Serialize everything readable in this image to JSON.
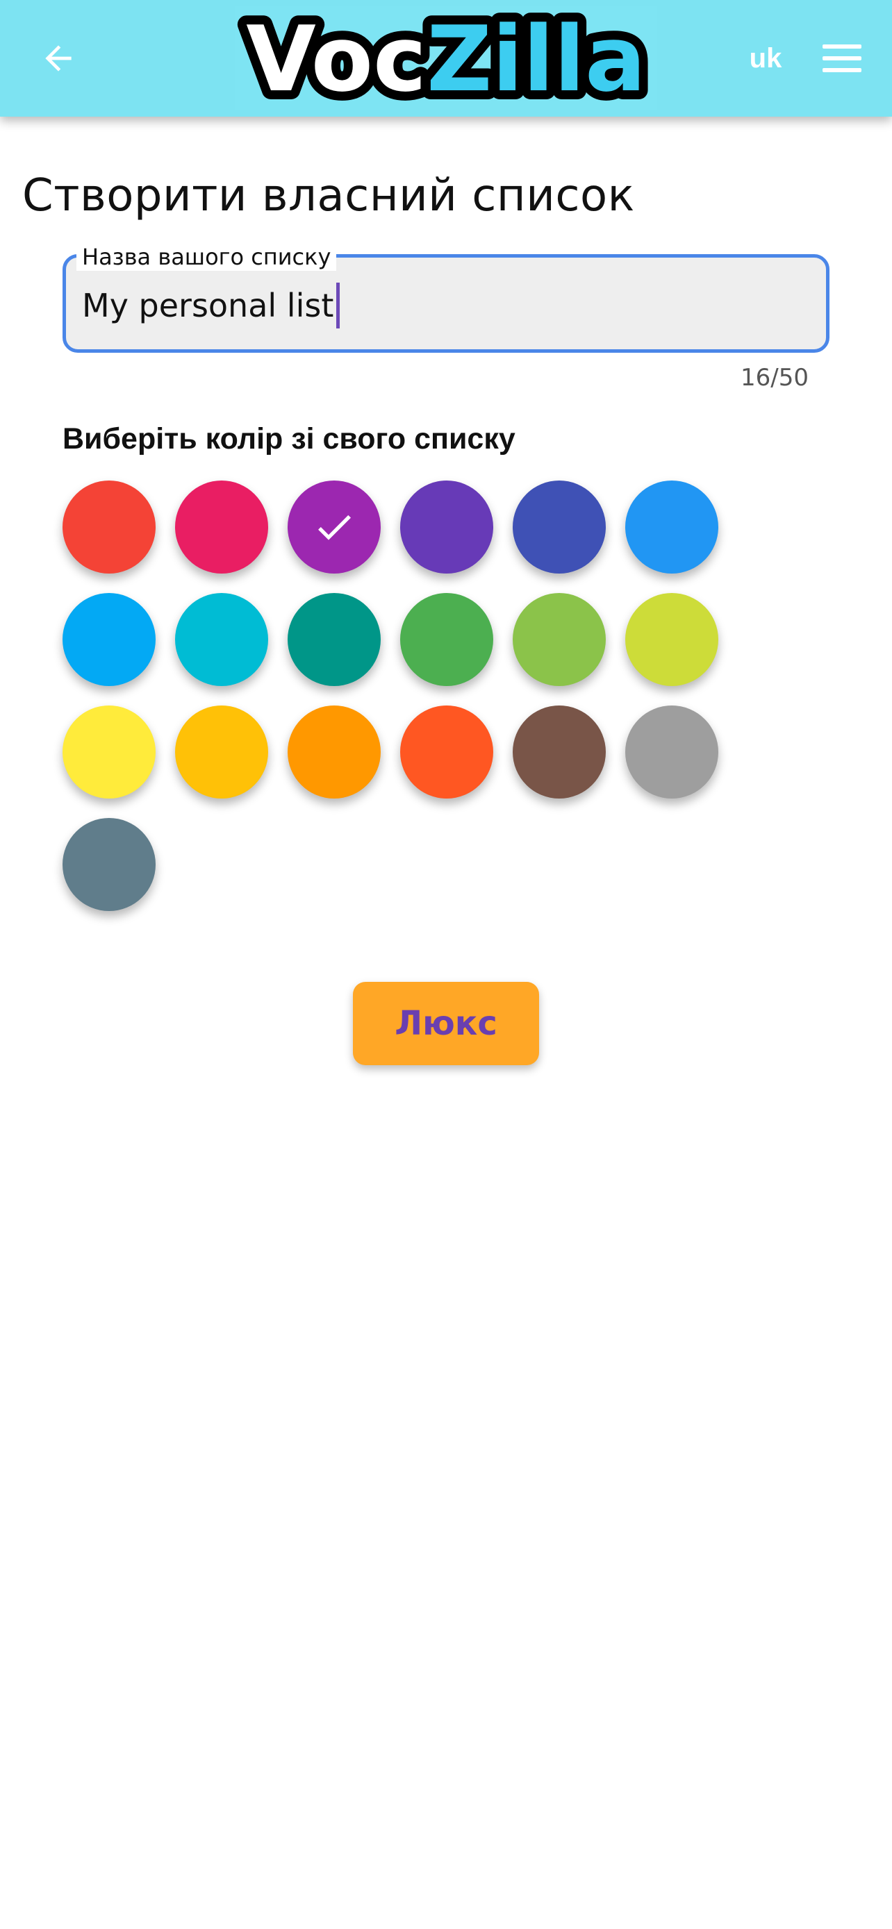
{
  "appbar": {
    "logo_text_a": "Voc",
    "logo_text_b": "Zilla",
    "language": "uk",
    "back_icon": "arrow-left-icon",
    "menu_icon": "hamburger-menu-icon",
    "background": "#7de3f2"
  },
  "page": {
    "title": "Створити власний список"
  },
  "name_field": {
    "label": "Назва вашого списку",
    "value": "My personal list",
    "counter": "16/50",
    "border_color": "#4a86e8"
  },
  "colors": {
    "heading": "Виберіть колір зі свого списку",
    "selected": "#9c27b0",
    "swatches": [
      "#f44336",
      "#e91e63",
      "#9c27b0",
      "#673ab7",
      "#3f51b5",
      "#2196f3",
      "#03a9f4",
      "#00bcd4",
      "#009688",
      "#4caf50",
      "#8bc34a",
      "#cddc39",
      "#ffeb3b",
      "#ffc107",
      "#ff9800",
      "#ff5722",
      "#795548",
      "#9e9e9e",
      "#607d8b"
    ]
  },
  "actions": {
    "luxe_label": "Люкс",
    "luxe_color": "#ffa726"
  }
}
